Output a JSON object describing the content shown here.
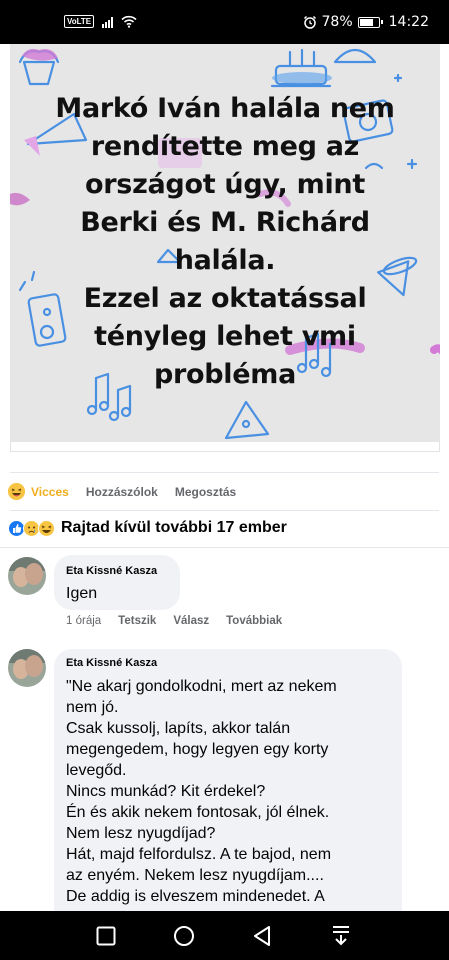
{
  "status_bar": {
    "volte": "VoLTE",
    "battery": "78%",
    "battery_level": 0.78,
    "time": "14:22"
  },
  "post": {
    "image_text_lines": [
      "Markó Iván halála nem",
      "rendítette meg az",
      "országot úgy, mint",
      "Berki és M. Richárd",
      "halála.",
      "Ezzel az oktatással",
      "tényleg lehet vmi",
      "probléma"
    ]
  },
  "reaction_bar": {
    "reaction_label": "Vicces",
    "comment_label": "Hozzászólok",
    "share_label": "Megosztás"
  },
  "reactions_summary": {
    "text": "Rajtad kívül további 17 ember"
  },
  "comments": [
    {
      "author": "Eta Kissné Kasza",
      "text": "Igen",
      "time": "1 órája",
      "like": "Tetszik",
      "reply": "Válasz",
      "more": "Továbbiak"
    },
    {
      "author": "Eta Kissné Kasza",
      "lines": [
        "\"Ne akarj gondolkodni, mert az nekem",
        "nem jó.",
        "Csak kussolj, lapíts, akkor talán",
        "megengedem, hogy legyen egy korty",
        "levegőd.",
        "Nincs munkád? Kit érdekel?",
        "Én és akik nekem fontosak, jól élnek.",
        "Nem lesz nyugdíjad?",
        "Hát, majd felfordulsz. A te bajod, nem",
        "az enyém. Nekem lesz nyugdíjam....",
        "De addig is elveszem mindenedet. A"
      ]
    }
  ],
  "nav_icons": [
    "recent-apps-icon",
    "home-icon",
    "back-icon",
    "notification-shade-icon"
  ]
}
